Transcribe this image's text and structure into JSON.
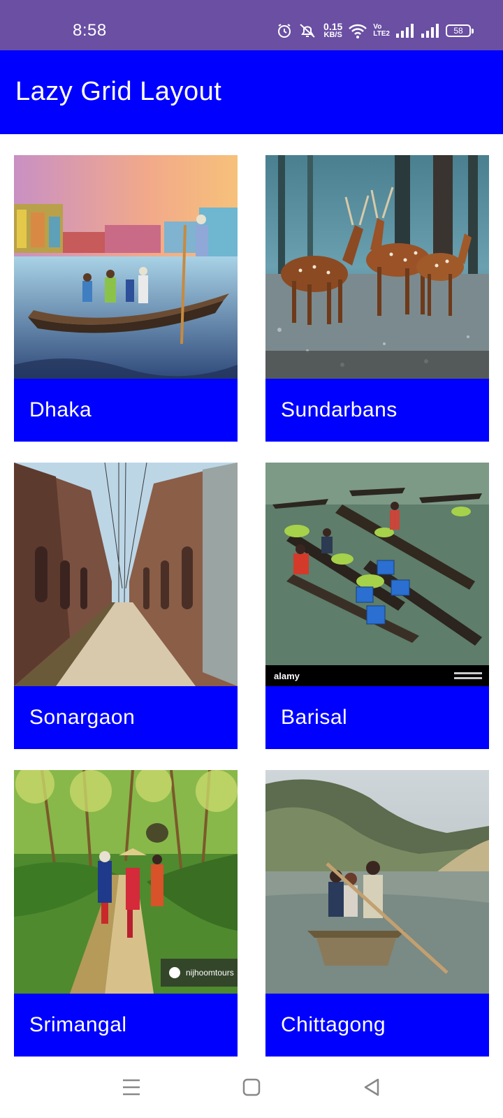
{
  "status_bar": {
    "time": "8:58",
    "net_speed_value": "0.15",
    "net_speed_unit": "KB/S",
    "volte_top": "Vo",
    "volte_bottom": "LTE2",
    "battery": "58",
    "icons": [
      "alarm-icon",
      "mute-icon",
      "wifi-icon",
      "signal-icon",
      "signal-icon",
      "battery-icon"
    ]
  },
  "app_bar": {
    "title": "Lazy Grid Layout"
  },
  "grid": {
    "items": [
      {
        "label": "Dhaka",
        "image": "boat-on-river-city"
      },
      {
        "label": "Sundarbans",
        "image": "spotted-deer-forest"
      },
      {
        "label": "Sonargaon",
        "image": "old-brick-street"
      },
      {
        "label": "Barisal",
        "image": "floating-market",
        "image_watermark": "alamy"
      },
      {
        "label": "Srimangal",
        "image": "tea-garden-path",
        "image_watermark": "nijhoomtours"
      },
      {
        "label": "Chittagong",
        "image": "boat-on-lake-hills"
      }
    ]
  },
  "colors": {
    "status_bar": "#6a4fa3",
    "app_bar": "#0000ff",
    "card_label": "#0000ff",
    "text_on_primary": "#ffffff"
  },
  "nav_bar": {
    "icons": [
      "menu-icon",
      "home-icon",
      "back-icon"
    ]
  }
}
